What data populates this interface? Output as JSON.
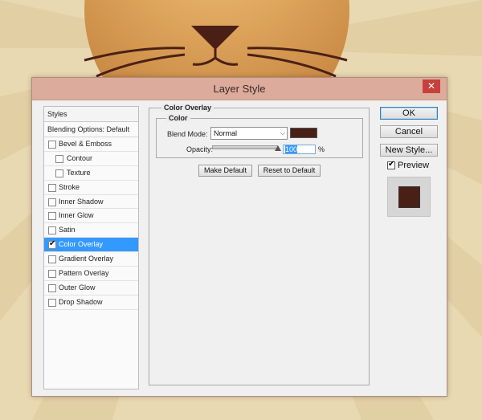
{
  "colors": {
    "overlay": "#4a2016",
    "selection": "#3399ff",
    "titlebar": "#dcab9b",
    "close": "#c7413c"
  },
  "dialog": {
    "title": "Layer Style",
    "close_icon": "close-icon"
  },
  "styles_panel": {
    "header": "Styles",
    "blending_options": "Blending Options: Default",
    "items": [
      {
        "label": "Bevel & Emboss",
        "checked": false,
        "indent": false
      },
      {
        "label": "Contour",
        "checked": false,
        "indent": true
      },
      {
        "label": "Texture",
        "checked": false,
        "indent": true
      },
      {
        "label": "Stroke",
        "checked": false,
        "indent": false
      },
      {
        "label": "Inner Shadow",
        "checked": false,
        "indent": false
      },
      {
        "label": "Inner Glow",
        "checked": false,
        "indent": false
      },
      {
        "label": "Satin",
        "checked": false,
        "indent": false
      },
      {
        "label": "Color Overlay",
        "checked": true,
        "indent": false,
        "selected": true
      },
      {
        "label": "Gradient Overlay",
        "checked": false,
        "indent": false
      },
      {
        "label": "Pattern Overlay",
        "checked": false,
        "indent": false
      },
      {
        "label": "Outer Glow",
        "checked": false,
        "indent": false
      },
      {
        "label": "Drop Shadow",
        "checked": false,
        "indent": false
      }
    ]
  },
  "color_overlay": {
    "section_title": "Color Overlay",
    "group_title": "Color",
    "blend_mode_label": "Blend Mode:",
    "blend_mode_value": "Normal",
    "opacity_label": "Opacity:",
    "opacity_value": "100",
    "opacity_unit": "%",
    "opacity_fraction": 1.0,
    "make_default": "Make Default",
    "reset_default": "Reset to Default"
  },
  "right_panel": {
    "ok": "OK",
    "cancel": "Cancel",
    "new_style": "New Style...",
    "preview_label": "Preview",
    "preview_checked": true
  }
}
